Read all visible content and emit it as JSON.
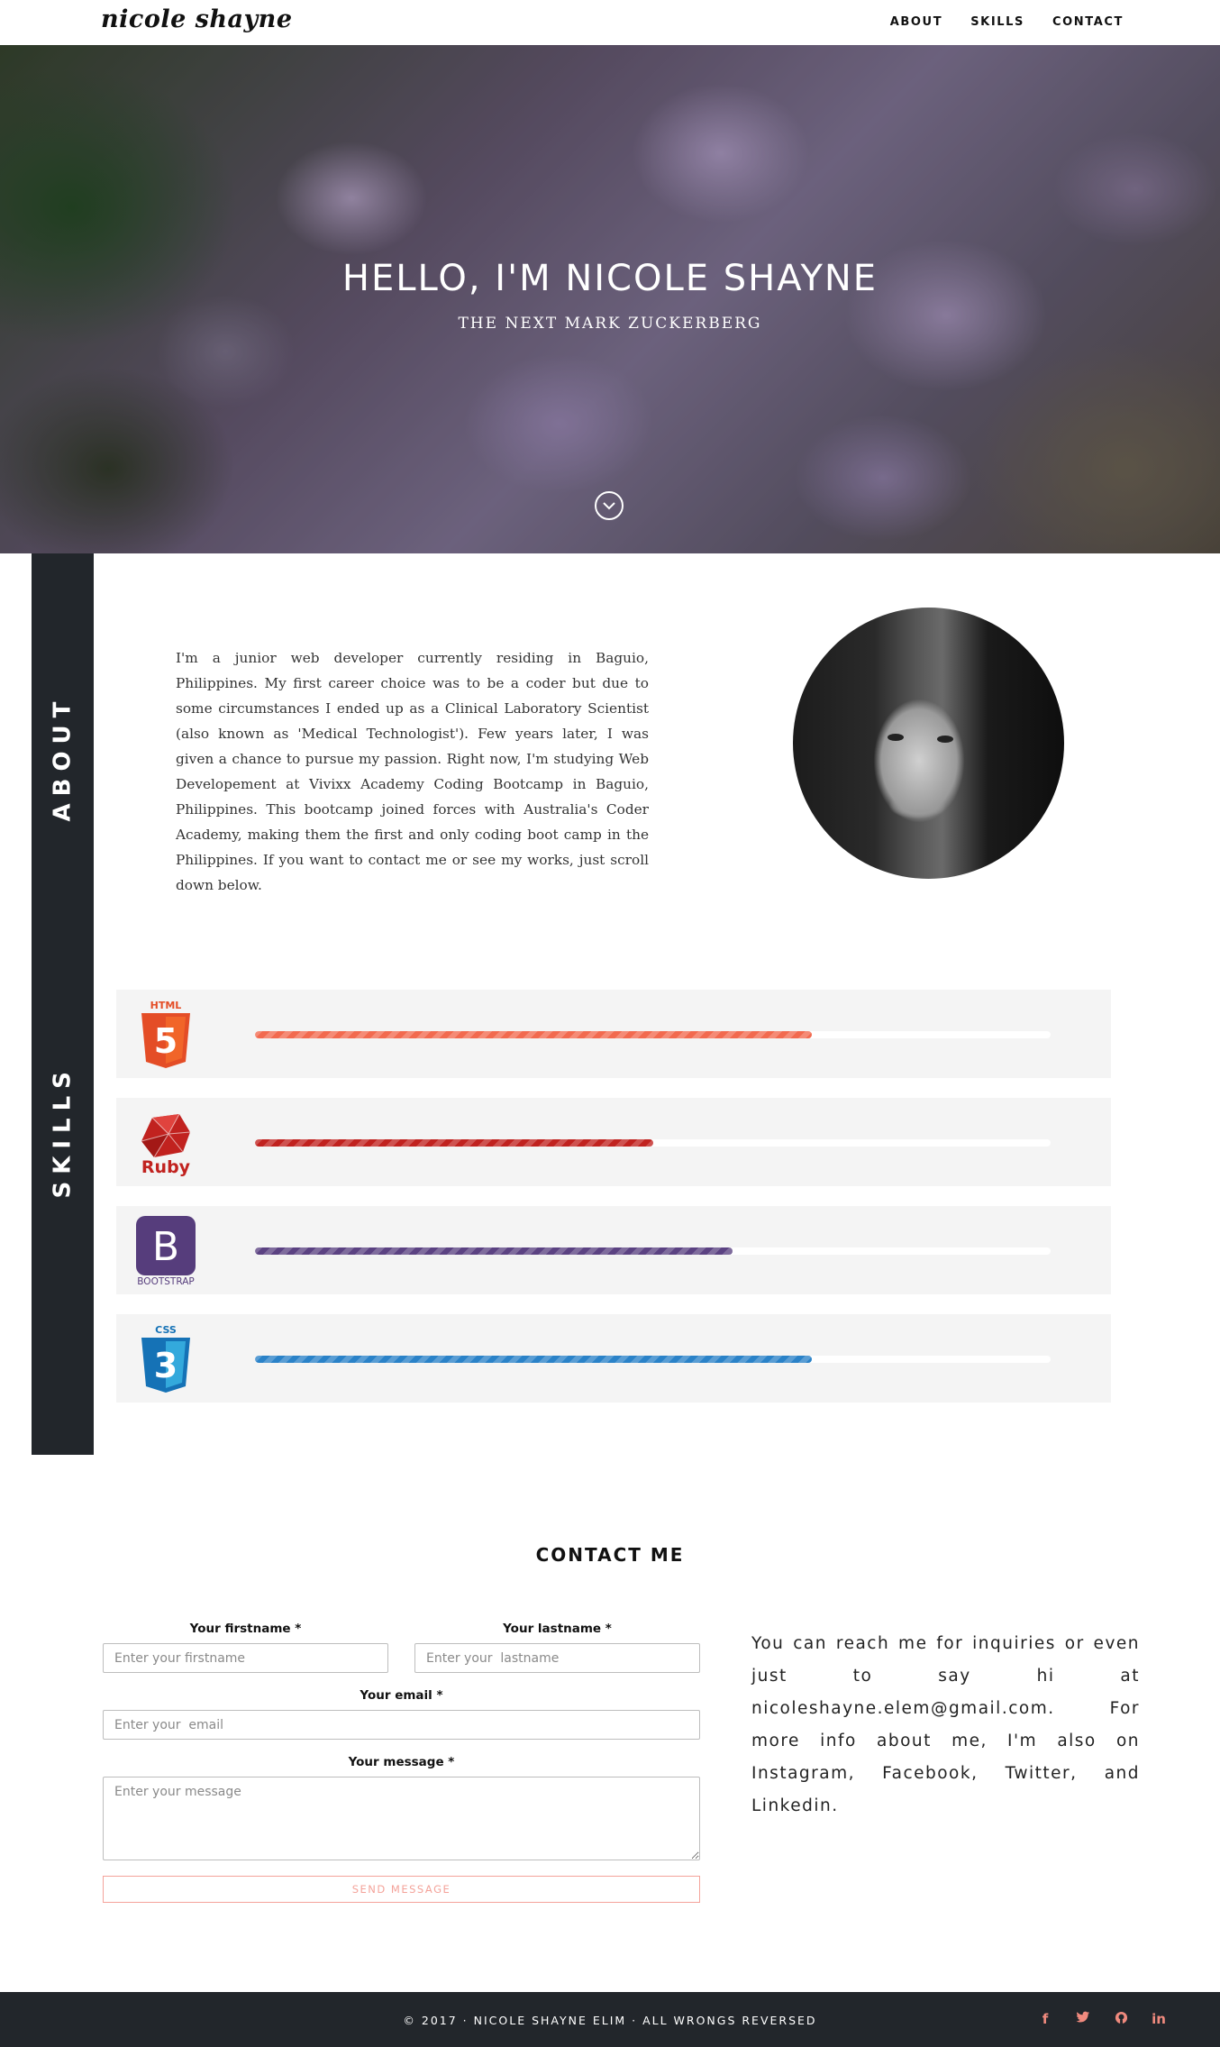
{
  "nav": {
    "brand": "nicole shayne",
    "links": [
      "ABOUT",
      "SKILLS",
      "CONTACT"
    ]
  },
  "hero": {
    "title": "HELLO, I'M NICOLE SHAYNE",
    "subtitle": "THE NEXT MARK ZUCKERBERG",
    "scroll_icon": "chevron-down-icon"
  },
  "sections": {
    "about_label": "ABOUT",
    "skills_label": "SKILLS"
  },
  "about": {
    "text": "I'm a junior web developer currently residing in Baguio, Philippines. My first career choice was to be a coder but due to some circumstances I ended up as a Clinical Laboratory Scientist (also known as 'Medical Technologist'). Few years later, I was given a chance to pursue my passion. Right now, I'm studying Web Developement at Vivixx Academy Coding Bootcamp in Baguio, Philippines. This bootcamp joined forces with Australia's Coder Academy, making them the first and only coding boot camp in the Philippines. If you want to contact me or see my works, just scroll down below."
  },
  "skills": [
    {
      "logo": "html5-logo",
      "logo_text": "HTML",
      "level": 0.7,
      "color": "#f26a4f"
    },
    {
      "logo": "ruby-logo",
      "logo_text": "Ruby",
      "level": 0.5,
      "color": "#c1221f"
    },
    {
      "logo": "bootstrap-logo",
      "logo_text": "BOOTSTRAP",
      "level": 0.6,
      "color": "#5b4282"
    },
    {
      "logo": "css3-logo",
      "logo_text": "CSS",
      "level": 0.7,
      "color": "#2a82c8"
    }
  ],
  "contact": {
    "title": "CONTACT ME",
    "firstname_label": "Your firstname *",
    "firstname_placeholder": "Enter your firstname",
    "lastname_label": "Your lastname *",
    "lastname_placeholder": "Enter your  lastname",
    "email_label": "Your email *",
    "email_placeholder": "Enter your  email",
    "message_label": "Your message *",
    "message_placeholder": "Enter your message",
    "send_label": "SEND MESSAGE",
    "info_text": "You can reach me for inquiries or even just to say hi at nicoleshayne.elem@gmail.com. For more info about me, I'm also on Instagram, Facebook, Twitter, and Linkedin."
  },
  "footer": {
    "text": "© 2017 · NICOLE SHAYNE ELIM · ALL WRONGS REVERSED",
    "socials": [
      {
        "icon": "facebook-icon",
        "glyph": "f"
      },
      {
        "icon": "twitter-icon",
        "glyph": "t"
      },
      {
        "icon": "github-icon",
        "glyph": "◔"
      },
      {
        "icon": "linkedin-icon",
        "glyph": "in"
      }
    ]
  },
  "colors": {
    "dark": "#22262b",
    "accent": "#f08a7e",
    "skill_bg": "#f4f4f4"
  }
}
